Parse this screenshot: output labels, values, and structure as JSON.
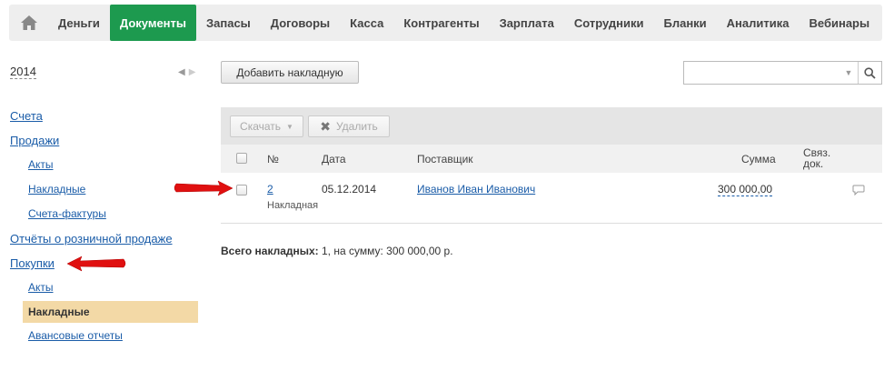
{
  "nav": {
    "home_icon": "home-icon",
    "items": [
      "Деньги",
      "Документы",
      "Запасы",
      "Договоры",
      "Касса",
      "Контрагенты",
      "Зарплата",
      "Сотрудники",
      "Бланки",
      "Аналитика",
      "Вебинары"
    ],
    "active_index": 1
  },
  "sidebar": {
    "year": "2014",
    "links": {
      "scheta": "Счета",
      "prodazhi": "Продажи",
      "akty1": "Акты",
      "nakladnye1": "Накладные",
      "schf": "Счета-фактуры",
      "rozn": "Отчёты о розничной продаже",
      "pokupki": "Покупки",
      "akty2": "Акты",
      "nakladnye_active": "Накладные",
      "avans": "Авансовые отчеты"
    }
  },
  "main": {
    "add_button": "Добавить накладную",
    "search": {
      "value": "",
      "placeholder": ""
    },
    "toolbar": {
      "download": "Скачать",
      "delete": "Удалить"
    },
    "columns": {
      "num": "№",
      "date": "Дата",
      "supplier": "Поставщик",
      "sum": "Сумма",
      "linked_1": "Связ.",
      "linked_2": "док."
    },
    "rows": [
      {
        "num": "2",
        "type": "Накладная",
        "date": "05.12.2014",
        "supplier": "Иванов Иван Иванович",
        "sum": "300 000,00"
      }
    ],
    "summary": {
      "label": "Всего накладных:",
      "text": " 1, на сумму: 300 000,00 р."
    }
  },
  "colors": {
    "accent": "#1d9a4f",
    "link": "#1a5ca8",
    "active_bg": "#f3d9a6",
    "annotation_arrow": "#e01010"
  }
}
